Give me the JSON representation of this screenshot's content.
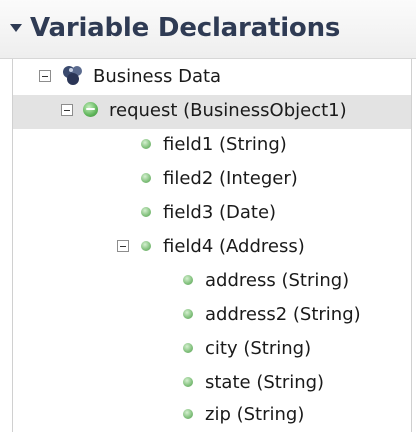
{
  "panel": {
    "title": "Variable Declarations"
  },
  "tree": {
    "business_data": "Business Data",
    "request": "request (BusinessObject1)",
    "field1": "field1 (String)",
    "filed2": "filed2 (Integer)",
    "field3": "field3 (Date)",
    "field4": "field4 (Address)",
    "address": "address (String)",
    "address2": "address2 (String)",
    "city": "city (String)",
    "state": "state (String)",
    "zip": "zip (String)"
  },
  "colors": {
    "title": "#2f3b54",
    "selection": "#e3e3e3",
    "field_dot": "#7fbf7a"
  }
}
